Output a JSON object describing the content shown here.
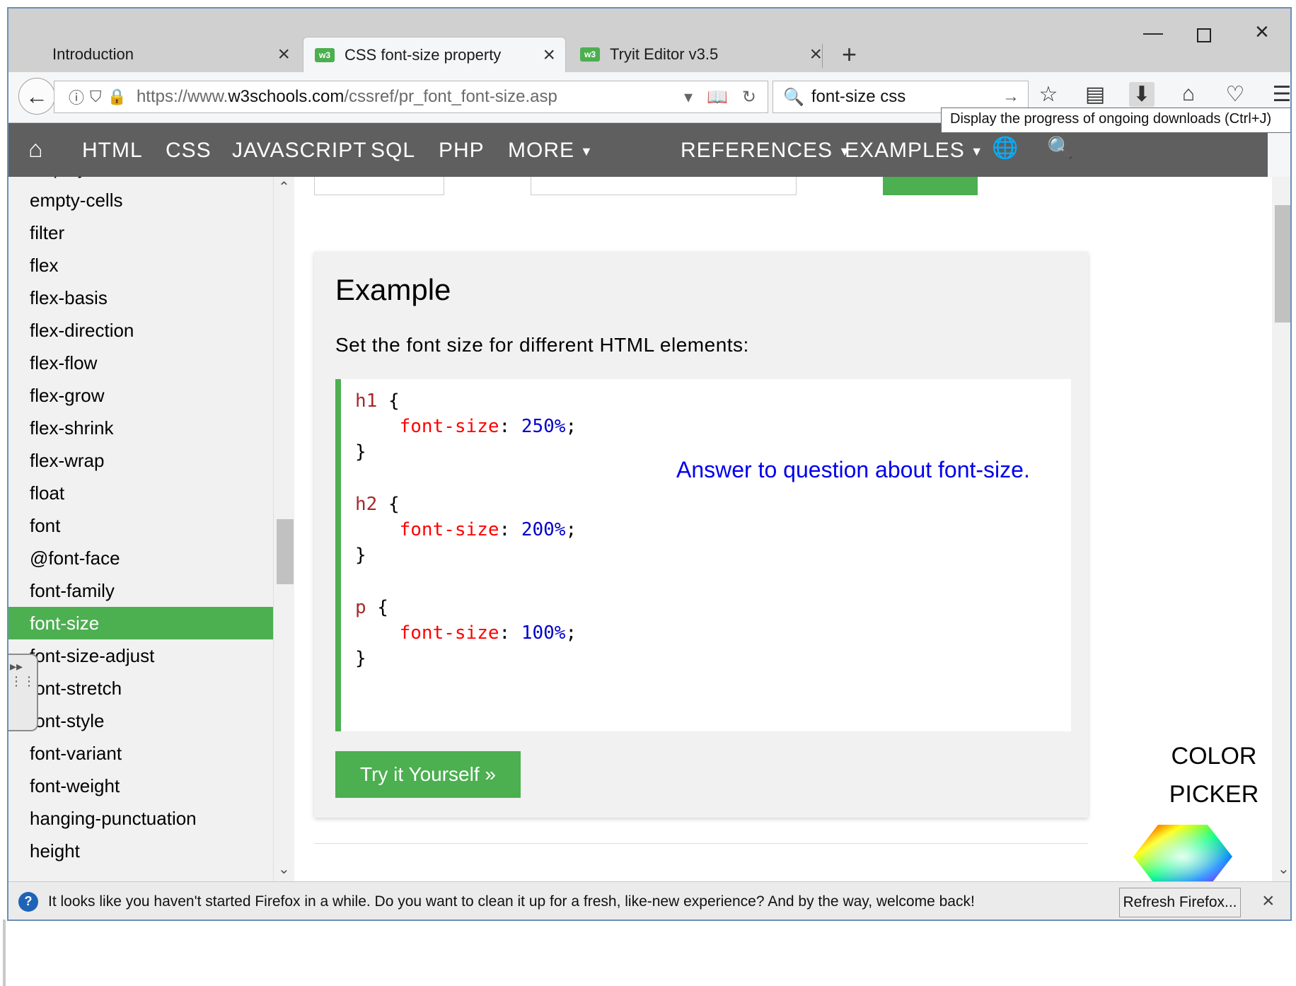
{
  "browser": {
    "tabs": [
      {
        "label": "Introduction",
        "favicon": ""
      },
      {
        "label": "CSS font-size property",
        "favicon": "w3"
      },
      {
        "label": "Tryit Editor v3.5",
        "favicon": "w3"
      }
    ],
    "url_prefix": "https://www.",
    "url_domain": "w3schools.com",
    "url_path": "/cssref/pr_font_font-size.asp",
    "search_value": "font-size css",
    "tooltip": "Display the progress of ongoing downloads (Ctrl+J)"
  },
  "w3nav": {
    "items": [
      "HTML",
      "CSS",
      "JAVASCRIPT",
      "SQL",
      "PHP",
      "MORE",
      "REFERENCES",
      "EXAMPLES"
    ]
  },
  "sidebar": {
    "items": [
      "display",
      "empty-cells",
      "filter",
      "flex",
      "flex-basis",
      "flex-direction",
      "flex-flow",
      "flex-grow",
      "flex-shrink",
      "flex-wrap",
      "float",
      "font",
      "@font-face",
      "font-family",
      "font-size",
      "font-size-adjust",
      "font-stretch",
      "font-style",
      "font-variant",
      "font-weight",
      "hanging-punctuation",
      "height"
    ],
    "active": "font-size"
  },
  "example": {
    "title": "Example",
    "description": "Set the font size for different HTML elements:",
    "code": [
      {
        "selector": "h1",
        "property": "font-size",
        "value": "250%"
      },
      {
        "selector": "h2",
        "property": "font-size",
        "value": "200%"
      },
      {
        "selector": "p",
        "property": "font-size",
        "value": "100%"
      }
    ],
    "answer_link": "Answer to question about font-size.",
    "try_button": "Try it Yourself »"
  },
  "color_picker": {
    "line1": "COLOR",
    "line2": "PICKER"
  },
  "notification": {
    "message": "It looks like you haven't started Firefox in a while. Do you want to clean it up for a fresh, like-new experience? And by the way, welcome back!",
    "button": "Refresh Firefox..."
  },
  "colors": {
    "w3_green": "#4caf50",
    "w3_nav": "#5f5f5f",
    "link_blue": "#0000ee"
  }
}
